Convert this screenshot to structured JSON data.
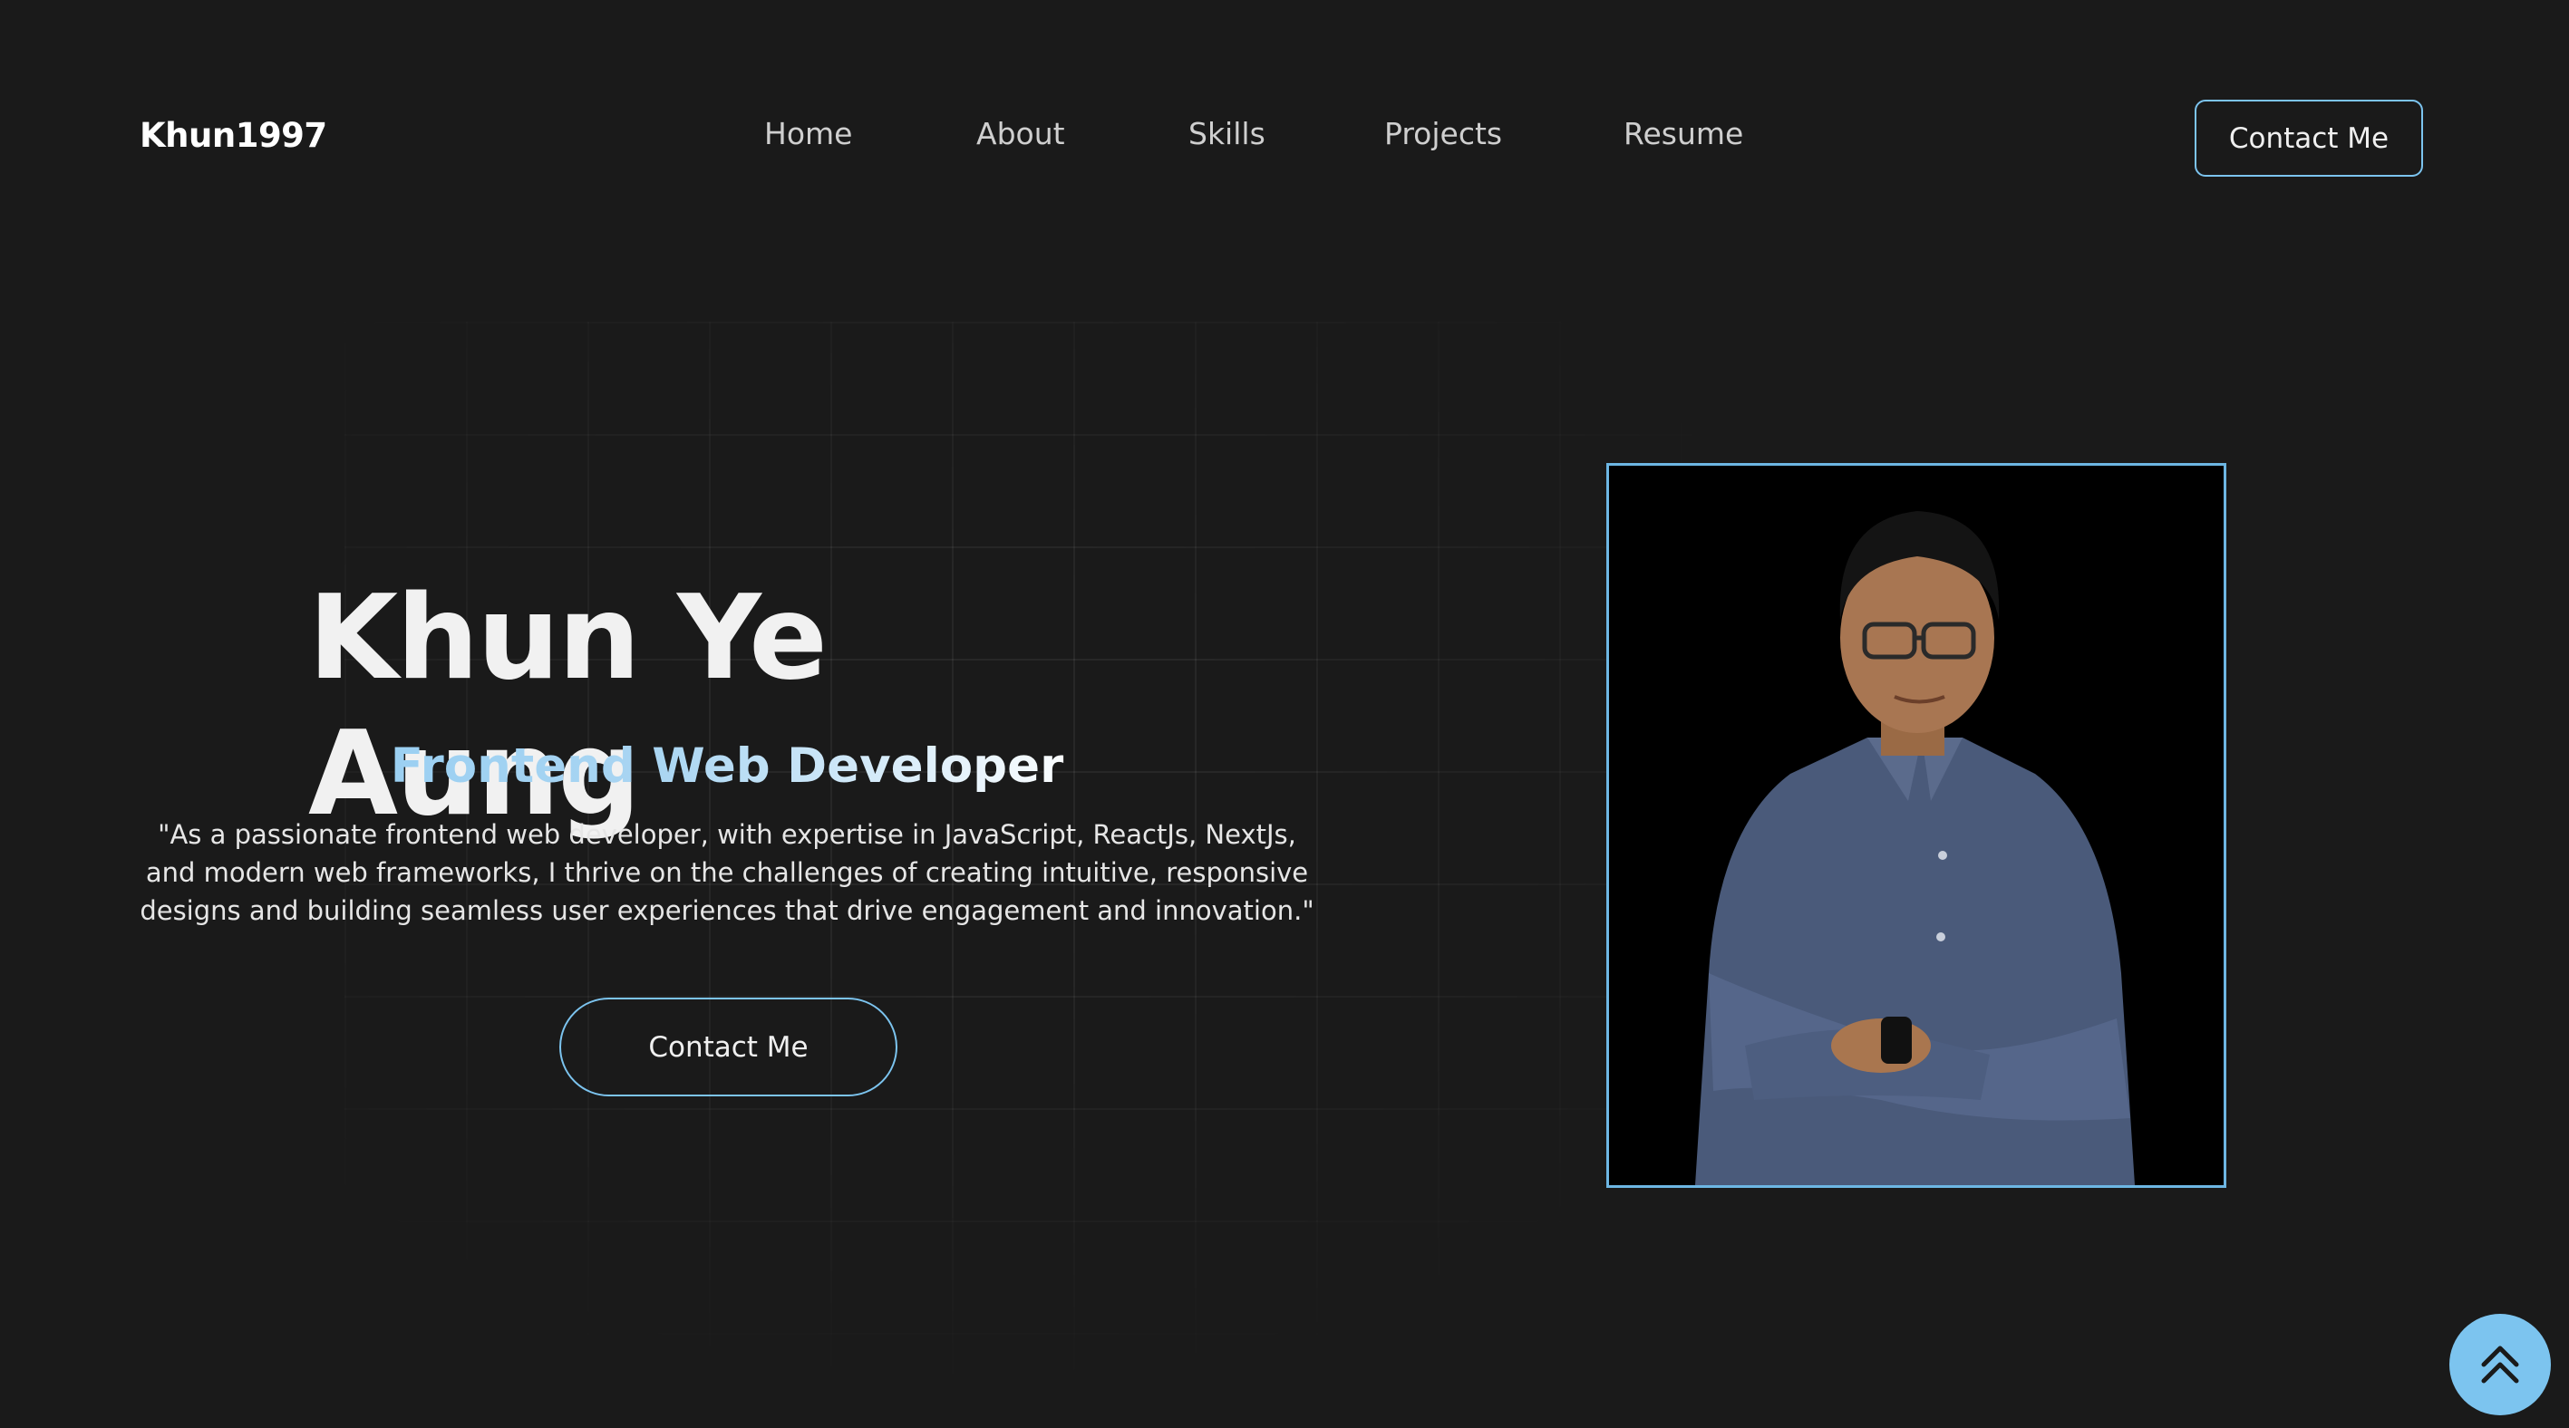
{
  "header": {
    "logo": "Khun1997",
    "nav": [
      "Home",
      "About",
      "Skills",
      "Projects",
      "Resume"
    ],
    "contact_label": "Contact Me"
  },
  "hero": {
    "name": "Khun Ye Aung",
    "role": "Frontend Web Developer",
    "quote": "\"As a passionate frontend web developer, with expertise in JavaScript, ReactJs, NextJs, and modern web frameworks, I thrive on the challenges of creating intuitive, responsive designs and building seamless user experiences that drive engagement and innovation.\"",
    "contact_label": "Contact Me"
  },
  "colors": {
    "background": "#1a1a1a",
    "accent": "#7cc4ef",
    "text": "#e9e9e9"
  },
  "icons": {
    "scroll_top": "double-chevron-up-icon"
  }
}
